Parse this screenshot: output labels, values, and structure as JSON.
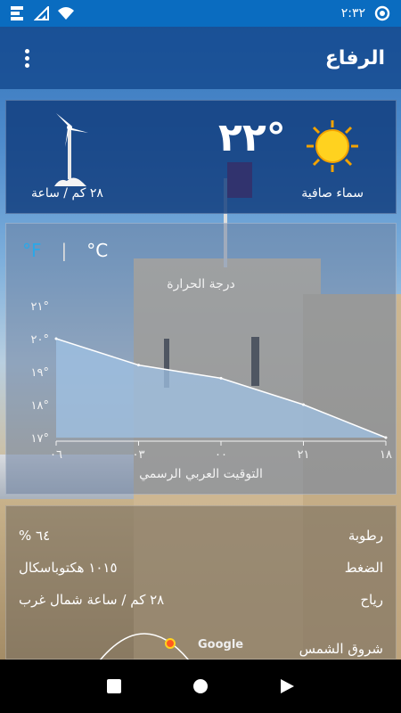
{
  "status_bar": {
    "time": "٢:٣٢"
  },
  "header": {
    "title": "الرفاع"
  },
  "current": {
    "temperature": "٢٢°",
    "condition": "سماء صافية",
    "wind": "٢٨ كم / ساعة"
  },
  "chart_card": {
    "unit_c": "°C",
    "unit_f": "°F",
    "separator": "|"
  },
  "chart_data": {
    "type": "area",
    "title": "درجة الحرارة",
    "xlabel": "التوقيت العربي الرسمي",
    "x": [
      "١٨",
      "٢١",
      "٠٠",
      "٠٣",
      "٠٦"
    ],
    "y_ticks": [
      "٢١°",
      "٢٠°",
      "١٩°",
      "١٨°",
      "١٧°"
    ],
    "y_values": [
      21,
      20,
      19,
      18,
      17
    ],
    "ylim": [
      17,
      21
    ],
    "series": [
      {
        "values": [
          20.0,
          19.2,
          18.8,
          18.0,
          17.0
        ]
      }
    ],
    "colors": {
      "fill": "#9fc2e4",
      "line": "#ffffff"
    }
  },
  "details": {
    "humidity_label": "رطوبة",
    "humidity_value": "٦٤ %",
    "pressure_label": "الضغط",
    "pressure_value": "١٠١٥ هكتوباسكال",
    "wind_label": "رياح",
    "wind_value": "٢٨ كم / ساعة شمال غرب",
    "sunrise_label": "شروق الشمس"
  },
  "map": {
    "attribution": "Google"
  }
}
